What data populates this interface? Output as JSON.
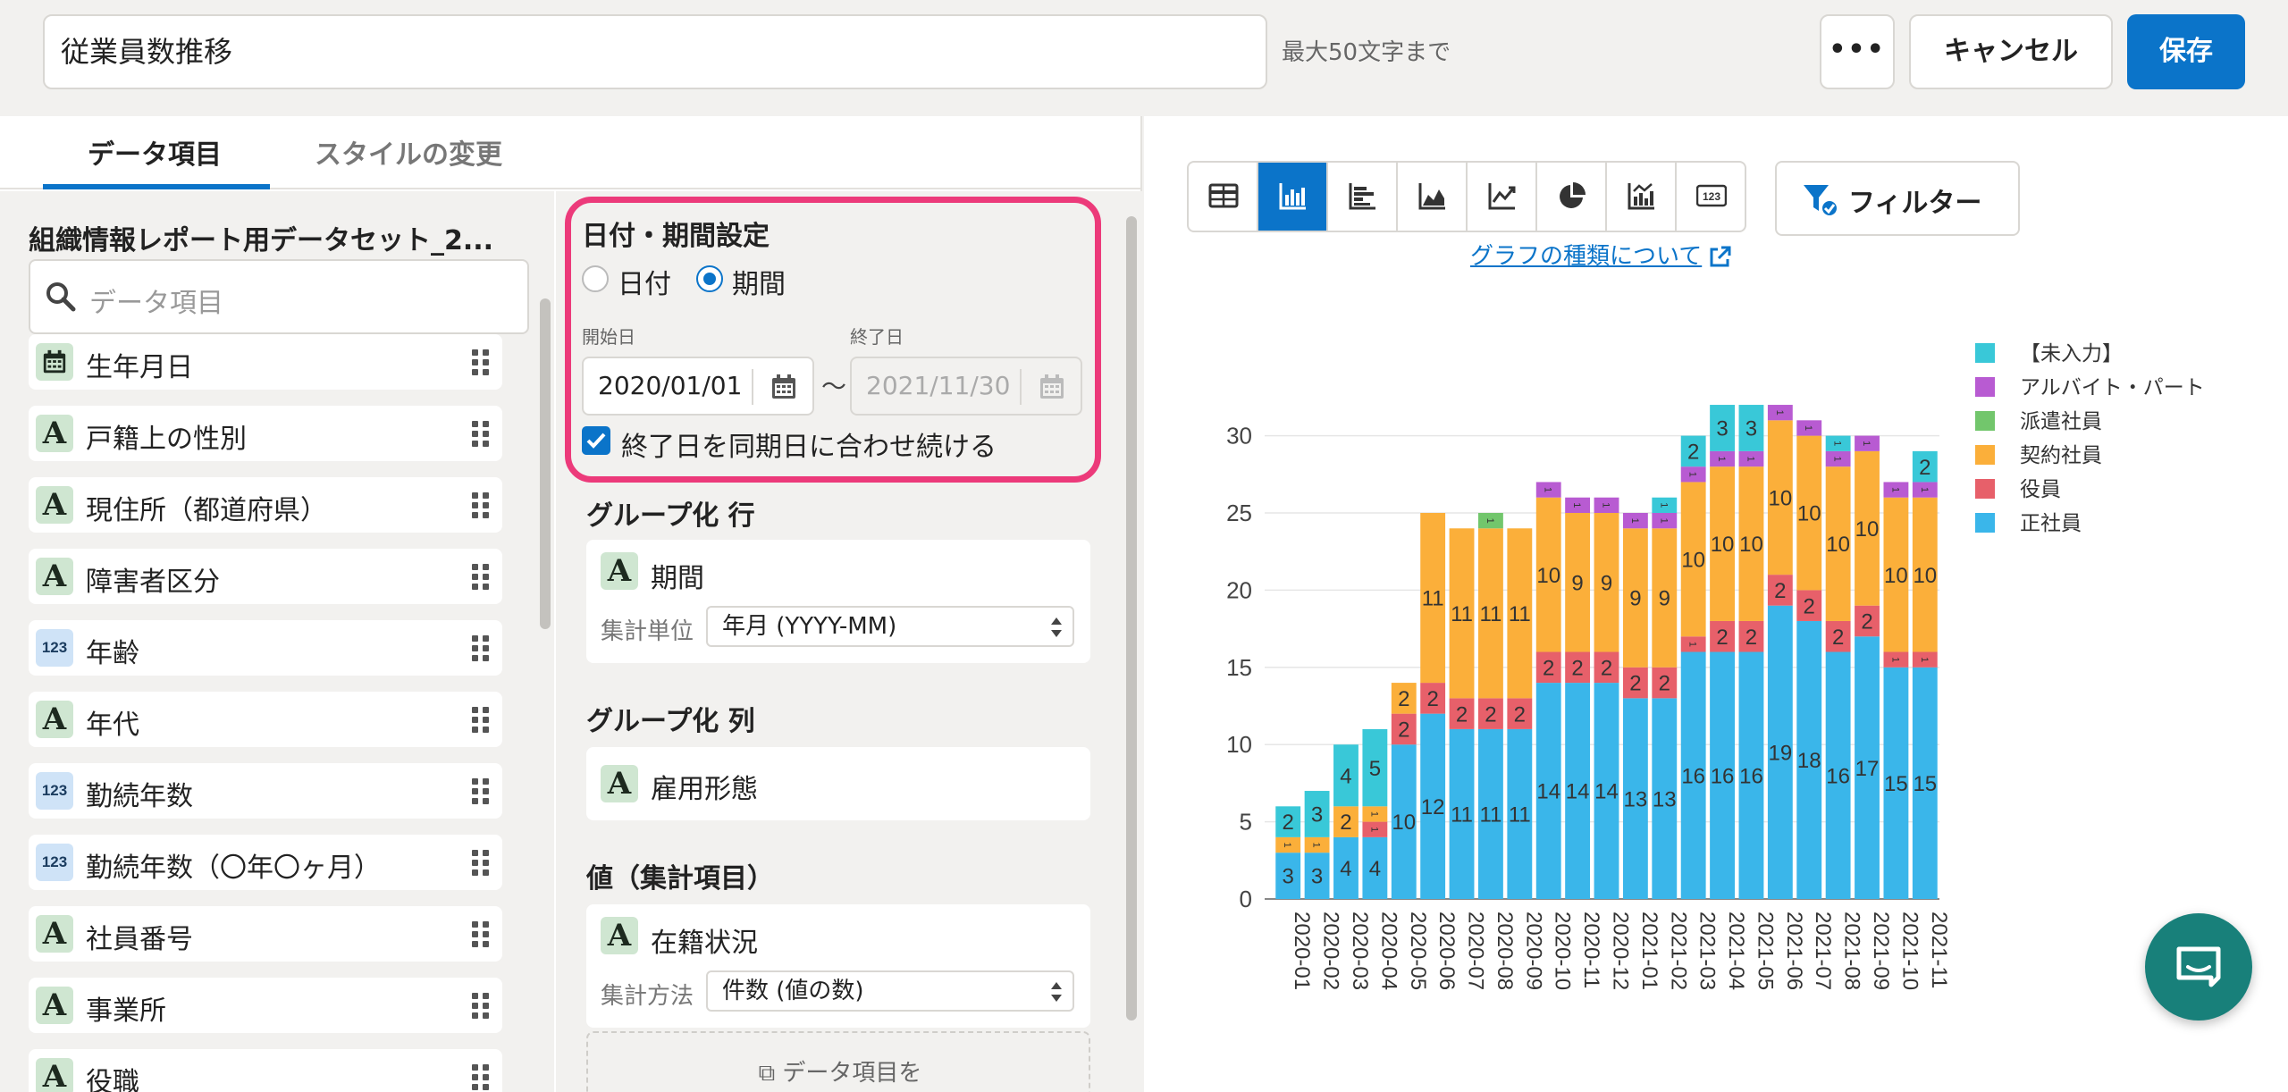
{
  "topbar": {
    "title_value": "従業員数推移",
    "max_chars_note": "最大50文字まで",
    "more_label": "•••",
    "cancel_label": "キャンセル",
    "save_label": "保存"
  },
  "tabs": [
    {
      "label": "データ項目",
      "active": true
    },
    {
      "label": "スタイルの変更",
      "active": false
    }
  ],
  "dataset": {
    "title": "組織情報レポート用データセット_2...",
    "search_placeholder": "データ項目"
  },
  "fields": [
    {
      "type": "calendar",
      "label": "生年月日"
    },
    {
      "type": "A",
      "label": "戸籍上の性別"
    },
    {
      "type": "A",
      "label": "現住所（都道府県）"
    },
    {
      "type": "A",
      "label": "障害者区分"
    },
    {
      "type": "123",
      "label": "年齢"
    },
    {
      "type": "A",
      "label": "年代"
    },
    {
      "type": "123",
      "label": "勤続年数"
    },
    {
      "type": "123",
      "label": "勤続年数（〇年〇ヶ月）"
    },
    {
      "type": "A",
      "label": "社員番号"
    },
    {
      "type": "A",
      "label": "事業所"
    },
    {
      "type": "A",
      "label": "役職"
    }
  ],
  "date_settings": {
    "title": "日付・期間設定",
    "radio_date": "日付",
    "radio_period": "期間",
    "selected": "期間",
    "start_label": "開始日",
    "end_label": "終了日",
    "start_value": "2020/01/01",
    "end_value": "2021/11/30",
    "tilde": "〜",
    "sync_label": "終了日を同期日に合わせ続ける",
    "sync_checked": true
  },
  "group_rows": {
    "title": "グループ化 行",
    "field": "期間",
    "unit_label": "集計単位",
    "unit_value": "年月 (YYYY-MM)"
  },
  "group_cols": {
    "title": "グループ化 列",
    "field": "雇用形態"
  },
  "values": {
    "title": "値（集計項目）",
    "field": "在籍状況",
    "method_label": "集計方法",
    "method_value": "件数 (値の数)"
  },
  "dropzone": {
    "text": "データ項目を"
  },
  "chart_toolbar": {
    "types": [
      "table-icon",
      "bar-chart-icon",
      "horizontal-bar-icon",
      "area-chart-icon",
      "line-chart-icon",
      "pie-chart-icon",
      "combo-chart-icon",
      "number-icon"
    ],
    "active": "bar-chart-icon",
    "filter_label": "フィルター",
    "graph_types_link": "グラフの種類について"
  },
  "colors": {
    "primary": "#0b74c9",
    "highlight": "#ec3a7a",
    "chat": "#18807a"
  },
  "chart_data": {
    "type": "bar",
    "stacked": true,
    "categories": [
      "2020-01",
      "2020-02",
      "2020-03",
      "2020-04",
      "2020-05",
      "2020-06",
      "2020-07",
      "2020-08",
      "2020-09",
      "2020-10",
      "2020-11",
      "2020-12",
      "2021-01",
      "2021-02",
      "2021-03",
      "2021-04",
      "2021-05",
      "2021-06",
      "2021-07",
      "2021-08",
      "2021-09",
      "2021-10",
      "2021-11"
    ],
    "ylim": [
      0,
      33
    ],
    "yticks": [
      0,
      5,
      10,
      15,
      20,
      25,
      30
    ],
    "grid": true,
    "legend_position": "right-top",
    "series": [
      {
        "name": "正社員",
        "color": "#3ab6ea",
        "values": [
          3,
          3,
          4,
          4,
          10,
          12,
          11,
          11,
          11,
          14,
          14,
          14,
          13,
          13,
          16,
          16,
          16,
          19,
          18,
          16,
          17,
          15,
          15
        ]
      },
      {
        "name": "役員",
        "color": "#e7606a",
        "values": [
          0,
          0,
          0,
          1,
          2,
          2,
          2,
          2,
          2,
          2,
          2,
          2,
          2,
          2,
          1,
          2,
          2,
          2,
          2,
          2,
          2,
          1,
          1
        ]
      },
      {
        "name": "契約社員",
        "color": "#fbaf3a",
        "values": [
          1,
          1,
          2,
          1,
          2,
          11,
          11,
          11,
          11,
          10,
          9,
          9,
          9,
          9,
          10,
          10,
          10,
          10,
          10,
          10,
          10,
          10,
          10
        ]
      },
      {
        "name": "派遣社員",
        "color": "#72c66c",
        "values": [
          0,
          0,
          0,
          0,
          0,
          0,
          0,
          1,
          0,
          0,
          0,
          0,
          0,
          0,
          0,
          0,
          0,
          0,
          0,
          0,
          0,
          0,
          0
        ]
      },
      {
        "name": "アルバイト・パート",
        "color": "#b85bd2",
        "values": [
          0,
          0,
          0,
          0,
          0,
          0,
          0,
          0,
          0,
          1,
          1,
          1,
          1,
          1,
          1,
          1,
          1,
          1,
          1,
          1,
          1,
          1,
          1
        ]
      },
      {
        "name": "【未入力】",
        "color": "#39c8d8",
        "values": [
          2,
          3,
          4,
          5,
          0,
          0,
          0,
          0,
          0,
          0,
          0,
          0,
          0,
          1,
          2,
          3,
          3,
          0,
          0,
          1,
          0,
          0,
          2
        ]
      }
    ],
    "legend_order": [
      "【未入力】",
      "アルバイト・パート",
      "派遣社員",
      "契約社員",
      "役員",
      "正社員"
    ]
  }
}
